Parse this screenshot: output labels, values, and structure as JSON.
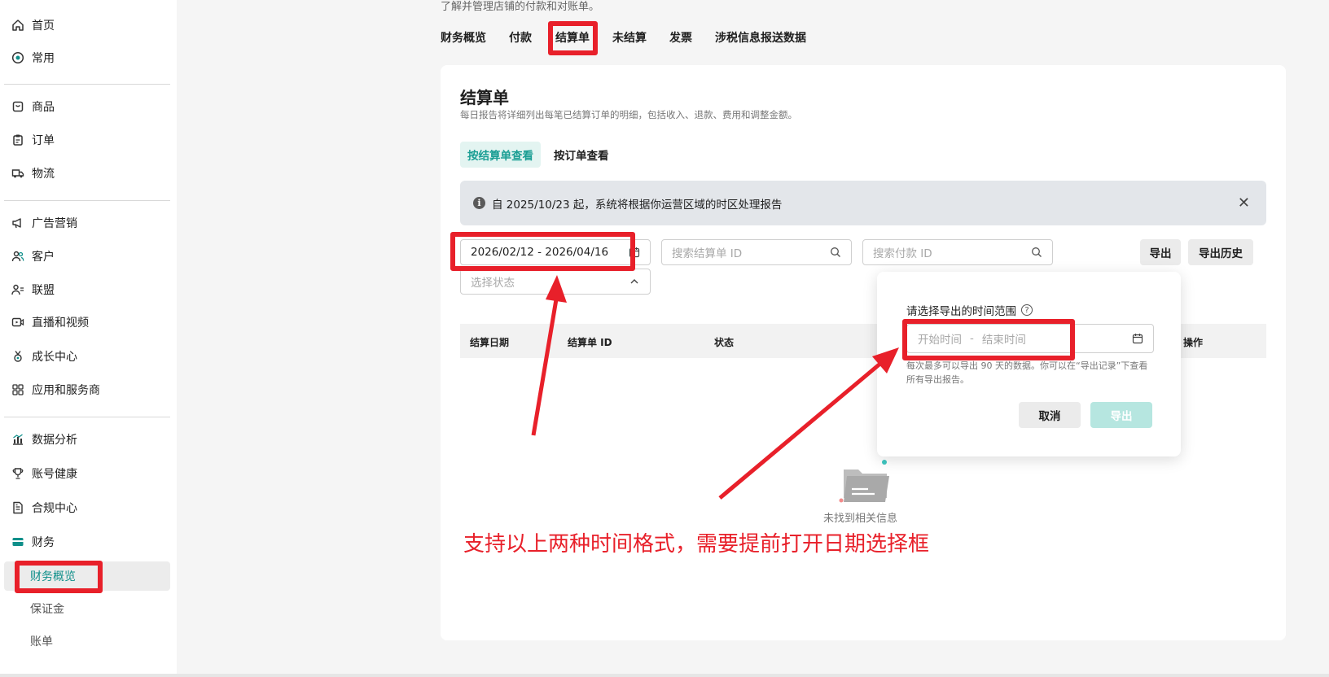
{
  "sidebar": {
    "items": [
      {
        "label": "首页",
        "icon": "home-icon"
      },
      {
        "label": "常用",
        "icon": "star-circle-icon"
      },
      {
        "label": "商品",
        "icon": "product-icon"
      },
      {
        "label": "订单",
        "icon": "clipboard-icon"
      },
      {
        "label": "物流",
        "icon": "truck-icon"
      },
      {
        "label": "广告营销",
        "icon": "megaphone-icon"
      },
      {
        "label": "客户",
        "icon": "users-icon"
      },
      {
        "label": "联盟",
        "icon": "affiliate-icon"
      },
      {
        "label": "直播和视频",
        "icon": "video-icon"
      },
      {
        "label": "成长中心",
        "icon": "medal-icon"
      },
      {
        "label": "应用和服务商",
        "icon": "apps-icon"
      },
      {
        "label": "数据分析",
        "icon": "bar-chart-icon"
      },
      {
        "label": "账号健康",
        "icon": "trophy-icon"
      },
      {
        "label": "合规中心",
        "icon": "compliance-icon"
      },
      {
        "label": "财务",
        "icon": "wallet-icon"
      }
    ],
    "finance_sub": [
      {
        "label": "财务概览",
        "active": true
      },
      {
        "label": "保证金",
        "active": false
      },
      {
        "label": "账单",
        "active": false
      }
    ]
  },
  "header": {
    "description": "了解并管理店铺的付款和对账单。",
    "tabs": [
      "财务概览",
      "付款",
      "结算单",
      "未结算",
      "发票",
      "涉税信息报送数据"
    ],
    "active_tab": "结算单"
  },
  "card": {
    "title": "结算单",
    "description": "每日报告将详细列出每笔已结算订单的明细，包括收入、退款、费用和调整金额。",
    "view_toggle": {
      "by_statement": "按结算单查看",
      "by_order": "按订单查看"
    },
    "notice": {
      "text": "自 2025/10/23 起，系统将根据你运营区域的时区处理报告"
    },
    "filters": {
      "date_range": "2026/02/12 - 2026/04/16",
      "search_statement_placeholder": "搜索结算单 ID",
      "search_payment_placeholder": "搜索付款 ID",
      "status_placeholder": "选择状态",
      "export_label": "导出",
      "export_history_label": "导出历史"
    },
    "table": {
      "columns": [
        "结算日期",
        "结算单 ID",
        "状态",
        "操作"
      ]
    },
    "empty_text": "未找到相关信息"
  },
  "export_popover": {
    "label": "请选择导出的时间范围",
    "start_placeholder": "开始时间",
    "separator": "-",
    "end_placeholder": "结束时间",
    "hint": "每次最多可以导出 90 天的数据。你可以在“导出记录”下查看所有导出报告。",
    "cancel_label": "取消",
    "export_label": "导出"
  },
  "annotation": {
    "text": "支持以上两种时间格式，需要提前打开日期选择框",
    "color": "#e8202a"
  },
  "colors": {
    "accent": "#1a9e94",
    "annotation_red": "#e8202a"
  }
}
